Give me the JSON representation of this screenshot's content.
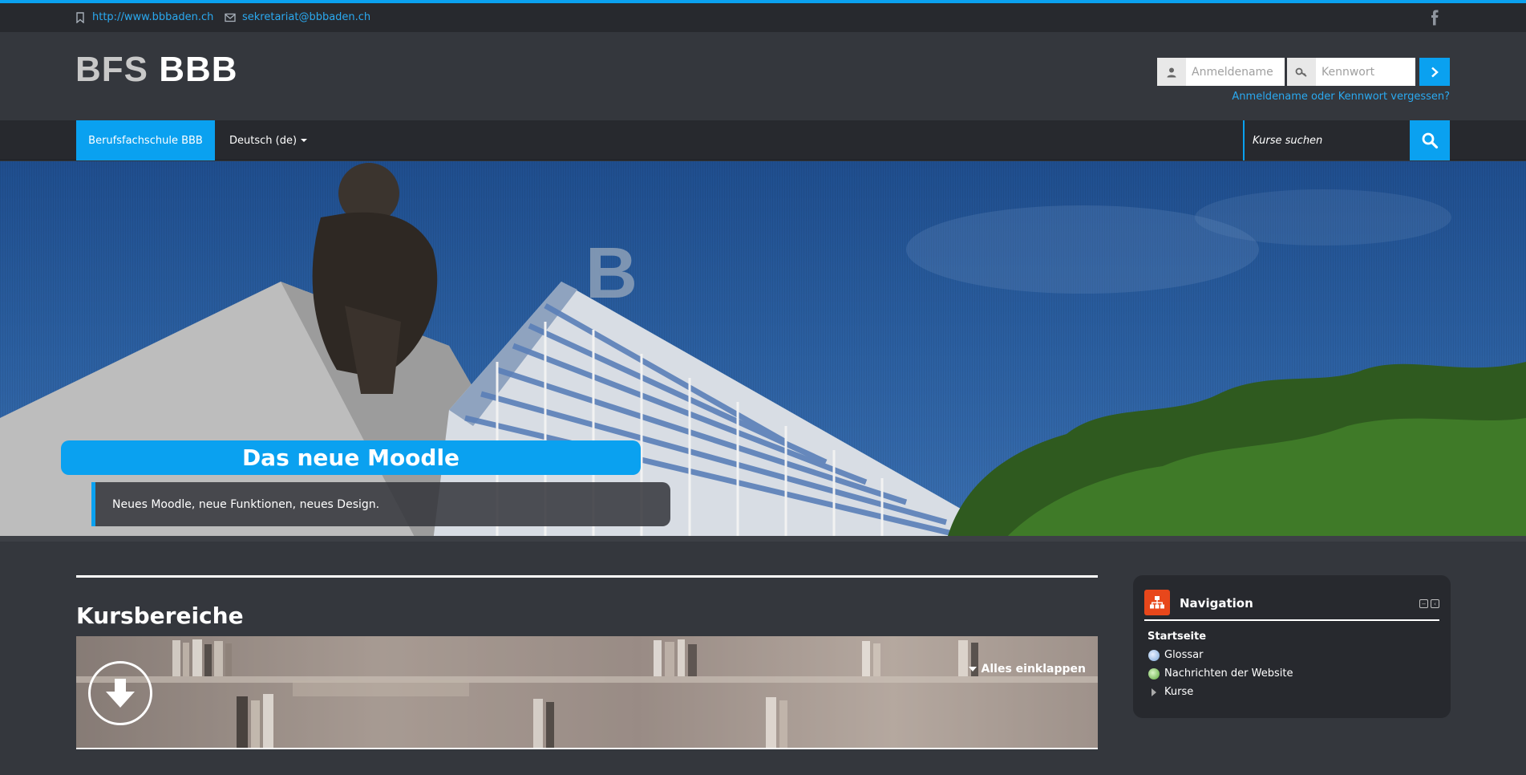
{
  "topbar": {
    "website": "http://www.bbbaden.ch",
    "email": "sekretariat@bbbaden.ch",
    "social_icon": "facebook-icon"
  },
  "header": {
    "logo_part1": "BFS",
    "logo_part2": "BBB"
  },
  "login": {
    "username_placeholder": "Anmeldename",
    "password_placeholder": "Kennwort",
    "submit_icon": "chevron-right-icon",
    "forgot_link": "Anmeldename oder Kennwort vergessen?"
  },
  "navbar": {
    "home_label": "Berufsfachschule BBB",
    "language_label": "Deutsch (de)",
    "search_placeholder": "Kurse suchen",
    "search_icon": "search-icon"
  },
  "hero": {
    "title": "Das neue Moodle",
    "caption": "Neues Moodle, neue Funktionen, neues Design."
  },
  "main": {
    "title": "Kursbereiche",
    "collapse_all": "Alles einklappen",
    "expand_icon": "arrow-down-circle-icon"
  },
  "navigation_block": {
    "title": "Navigation",
    "items": [
      {
        "label": "Startseite"
      },
      {
        "label": "Glossar"
      },
      {
        "label": "Nachrichten der Website"
      },
      {
        "label": "Kurse"
      }
    ]
  },
  "colors": {
    "accent": "#0aa1f0",
    "background": "#34373d",
    "bar": "#27292e",
    "block_icon": "#e8471b"
  }
}
